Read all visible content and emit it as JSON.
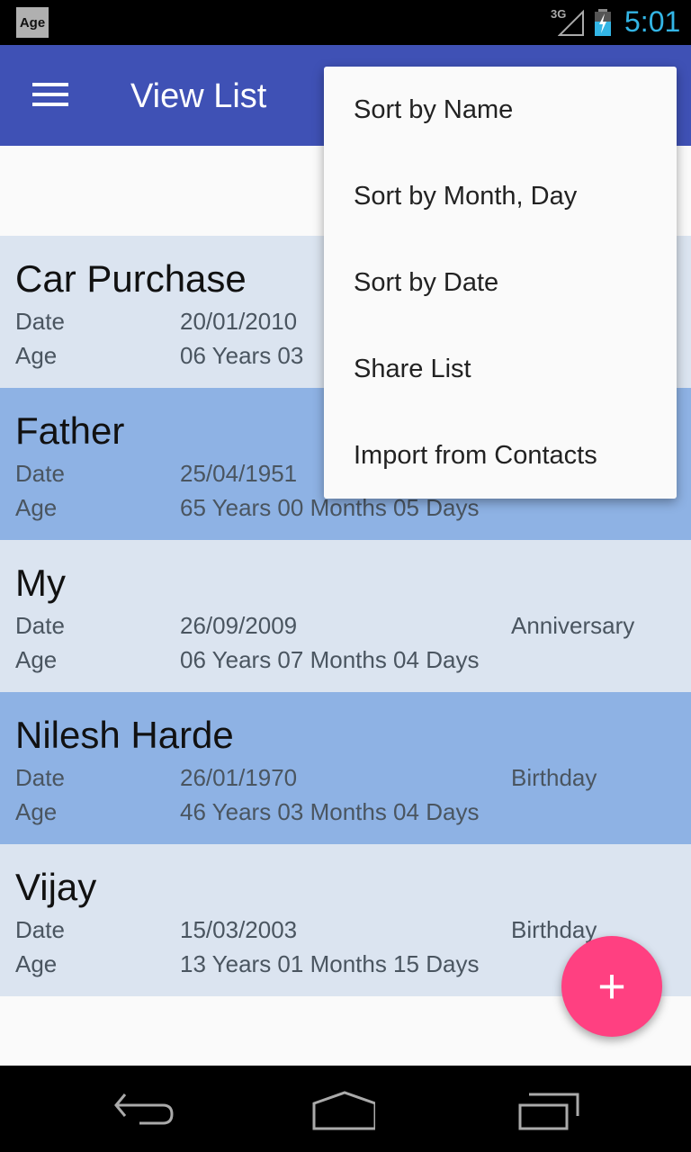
{
  "status_bar": {
    "app_icon_label": "Age",
    "network": "3G",
    "time": "5:01"
  },
  "app_bar": {
    "title": "View List",
    "menu_icon": "hamburger-menu-icon"
  },
  "overflow_menu": {
    "items": [
      {
        "label": "Sort by Name"
      },
      {
        "label": "Sort by Month, Day"
      },
      {
        "label": "Sort by Date"
      },
      {
        "label": "Share List"
      },
      {
        "label": "Import from Contacts"
      }
    ]
  },
  "list": {
    "date_label": "Date",
    "age_label": "Age",
    "items": [
      {
        "name": "Car Purchase",
        "date": "20/01/2010",
        "age": "06 Years 03",
        "type": ""
      },
      {
        "name": "Father",
        "date": "25/04/1951",
        "age": "65 Years 00 Months 05 Days",
        "type": ""
      },
      {
        "name": "My",
        "date": "26/09/2009",
        "age": "06 Years 07 Months 04 Days",
        "type": "Anniversary"
      },
      {
        "name": "Nilesh Harde",
        "date": "26/01/1970",
        "age": "46 Years 03 Months 04 Days",
        "type": "Birthday"
      },
      {
        "name": "Vijay",
        "date": "15/03/2003",
        "age": "13 Years 01 Months 15 Days",
        "type": "Birthday"
      }
    ]
  },
  "fab": {
    "label": "+",
    "icon": "add-icon"
  },
  "colors": {
    "primary": "#3f51b5",
    "accent": "#ff4081",
    "row_light": "#dbe4f0",
    "row_dark": "#8eb2e4",
    "clock": "#33b5e5"
  }
}
